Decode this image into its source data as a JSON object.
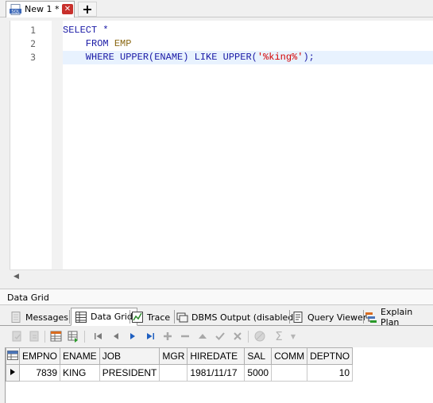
{
  "tabbar": {
    "tab_title": "New 1 *",
    "sql_icon_label": "SQL",
    "close_glyph": "✕",
    "new_tab_glyph": "+"
  },
  "editor": {
    "line_numbers": [
      "1",
      "2",
      "3"
    ],
    "lines": [
      [
        {
          "t": "SELECT *",
          "c": "kw"
        }
      ],
      [
        {
          "t": "    FROM ",
          "c": "kw"
        },
        {
          "t": "EMP",
          "c": "id"
        }
      ],
      [
        {
          "t": "    WHERE UPPER(ENAME) LIKE UPPER(",
          "c": "kw"
        },
        {
          "t": "'%king%'",
          "c": "str"
        },
        {
          "t": ");",
          "c": "kw"
        }
      ]
    ]
  },
  "section_label": "Data Grid",
  "result_tabs": [
    {
      "label": "Messages",
      "icon": "messages-icon"
    },
    {
      "label": "Data Grid",
      "icon": "data-grid-icon",
      "active": true
    },
    {
      "label": "Trace",
      "icon": "trace-icon"
    },
    {
      "label": "DBMS Output (disabled)",
      "icon": "dbms-output-icon"
    },
    {
      "label": "Query Viewer",
      "icon": "query-viewer-icon"
    },
    {
      "label": "Explain Plan",
      "icon": "explain-plan-icon"
    }
  ],
  "grid": {
    "columns": [
      "EMPNO",
      "ENAME",
      "JOB",
      "MGR",
      "HIREDATE",
      "SAL",
      "COMM",
      "DEPTNO"
    ],
    "rows": [
      [
        "7839",
        "KING",
        "PRESIDENT",
        "",
        "1981/11/17",
        "5000",
        "",
        "10"
      ]
    ],
    "numeric_columns": [
      0,
      7
    ]
  },
  "colors": {
    "keyword": "#1a1aa6",
    "identifier": "#8b6914",
    "string": "#d40000",
    "current_line": "#e8f2fe"
  }
}
